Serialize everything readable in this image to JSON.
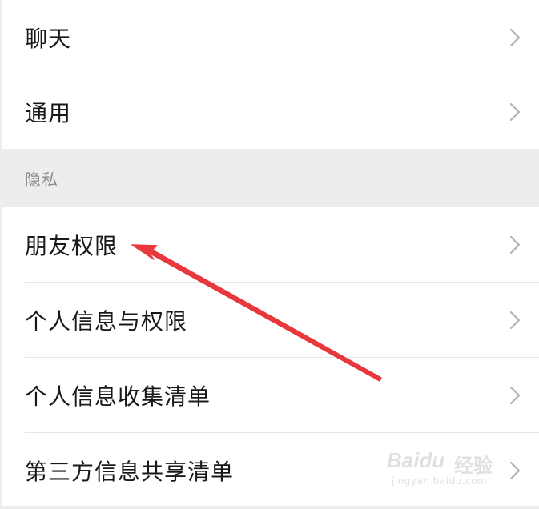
{
  "settings": {
    "items_top": [
      {
        "label": "聊天",
        "icon": "chevron-right-icon"
      },
      {
        "label": "通用",
        "icon": "chevron-right-icon"
      }
    ],
    "section": {
      "title": "隐私"
    },
    "items_privacy": [
      {
        "label": "朋友权限",
        "icon": "chevron-right-icon"
      },
      {
        "label": "个人信息与权限",
        "icon": "chevron-right-icon"
      },
      {
        "label": "个人信息收集清单",
        "icon": "chevron-right-icon"
      },
      {
        "label": "第三方信息共享清单",
        "icon": "chevron-right-icon"
      }
    ]
  },
  "annotation": {
    "arrow_color": "#e8383d",
    "points_to": "朋友权限"
  },
  "watermark": {
    "brand": "Baidu",
    "brand_cn": "经验",
    "url": "jingyan.baidu.com"
  },
  "colors": {
    "background": "#ffffff",
    "section_bg": "#ededed",
    "text": "#191919",
    "section_text": "#8a8a8a",
    "divider": "#e6e6e6",
    "chevron": "#b2b2b2"
  }
}
